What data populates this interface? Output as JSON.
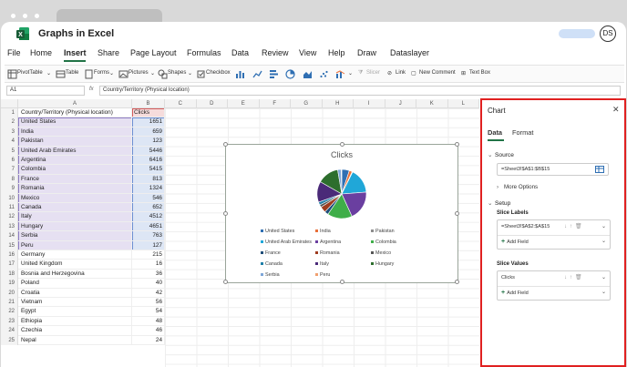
{
  "app": {
    "title": "Graphs in Excel",
    "user_initials": "DS"
  },
  "menu": [
    "File",
    "Home",
    "Insert",
    "Share",
    "Page Layout",
    "Formulas",
    "Data",
    "Review",
    "View",
    "Help",
    "Draw",
    "Dataslayer"
  ],
  "menu_active": "Insert",
  "ribbon": {
    "pivottable": "PivotTable",
    "table": "Table",
    "forms": "Forms",
    "pictures": "Pictures",
    "shapes": "Shapes",
    "checkbox": "Checkbox",
    "slicer": "Slicer",
    "link": "Link",
    "new_comment": "New Comment",
    "text_box": "Text Box"
  },
  "formula_bar": {
    "name_box": "A1",
    "fx": "fx",
    "content": "Country/Territory (Physical location)"
  },
  "sheet": {
    "columns": [
      "A",
      "B",
      "C",
      "D",
      "E",
      "F",
      "G",
      "H",
      "I",
      "J",
      "K",
      "L"
    ],
    "header": {
      "a": "Country/Territory (Physical location)",
      "b": "Clicks"
    },
    "rows": [
      {
        "n": "2",
        "country": "United States",
        "clicks": "1651"
      },
      {
        "n": "3",
        "country": "India",
        "clicks": "659"
      },
      {
        "n": "4",
        "country": "Pakistan",
        "clicks": "123"
      },
      {
        "n": "5",
        "country": "United Arab Emirates",
        "clicks": "5446"
      },
      {
        "n": "6",
        "country": "Argentina",
        "clicks": "6416"
      },
      {
        "n": "7",
        "country": "Colombia",
        "clicks": "5415"
      },
      {
        "n": "8",
        "country": "France",
        "clicks": "813"
      },
      {
        "n": "9",
        "country": "Romania",
        "clicks": "1324"
      },
      {
        "n": "10",
        "country": "Mexico",
        "clicks": "546"
      },
      {
        "n": "11",
        "country": "Canada",
        "clicks": "652"
      },
      {
        "n": "12",
        "country": "Italy",
        "clicks": "4512"
      },
      {
        "n": "13",
        "country": "Hungary",
        "clicks": "4651"
      },
      {
        "n": "14",
        "country": "Serbia",
        "clicks": "763"
      },
      {
        "n": "15",
        "country": "Peru",
        "clicks": "127"
      },
      {
        "n": "16",
        "country": "Germany",
        "clicks": "215"
      },
      {
        "n": "17",
        "country": "United Kingdom",
        "clicks": "16"
      },
      {
        "n": "18",
        "country": "Bosnia and Herzegovina",
        "clicks": "36"
      },
      {
        "n": "19",
        "country": "Poland",
        "clicks": "40"
      },
      {
        "n": "20",
        "country": "Croatia",
        "clicks": "42"
      },
      {
        "n": "21",
        "country": "Vietnam",
        "clicks": "56"
      },
      {
        "n": "22",
        "country": "Egypt",
        "clicks": "54"
      },
      {
        "n": "23",
        "country": "Ethiopia",
        "clicks": "48"
      },
      {
        "n": "24",
        "country": "Czechia",
        "clicks": "46"
      },
      {
        "n": "25",
        "country": "Nepal",
        "clicks": "24"
      }
    ]
  },
  "chart_data": {
    "type": "pie",
    "title": "Clicks",
    "categories": [
      "United States",
      "India",
      "Pakistan",
      "United Arab Emirates",
      "Argentina",
      "Colombia",
      "France",
      "Romania",
      "Mexico",
      "Canada",
      "Italy",
      "Hungary",
      "Serbia",
      "Peru"
    ],
    "values": [
      1651,
      659,
      123,
      5446,
      6416,
      5415,
      813,
      1324,
      546,
      652,
      4512,
      4651,
      763,
      127
    ],
    "colors": [
      "#2f6fb3",
      "#e8703a",
      "#8c8c8c",
      "#20a7d8",
      "#6a3fa0",
      "#3fae49",
      "#1f4e79",
      "#9e3b1e",
      "#555555",
      "#1f7fa8",
      "#4a2a78",
      "#2d6e2d",
      "#7ea6d8",
      "#f0a070"
    ],
    "legend_position": "bottom"
  },
  "panel": {
    "title": "Chart",
    "tabs": [
      "Data",
      "Format"
    ],
    "source_label": "Source",
    "source_value": "=Sheet3!$A$1:$B$15",
    "more_options": "More Options",
    "setup_label": "Setup",
    "slice_labels_label": "Slice Labels",
    "slice_labels_value": "=Sheet3!$A$2:$A$15",
    "slice_values_label": "Slice Values",
    "slice_values_value": "Clicks",
    "add_field": "Add Field"
  }
}
